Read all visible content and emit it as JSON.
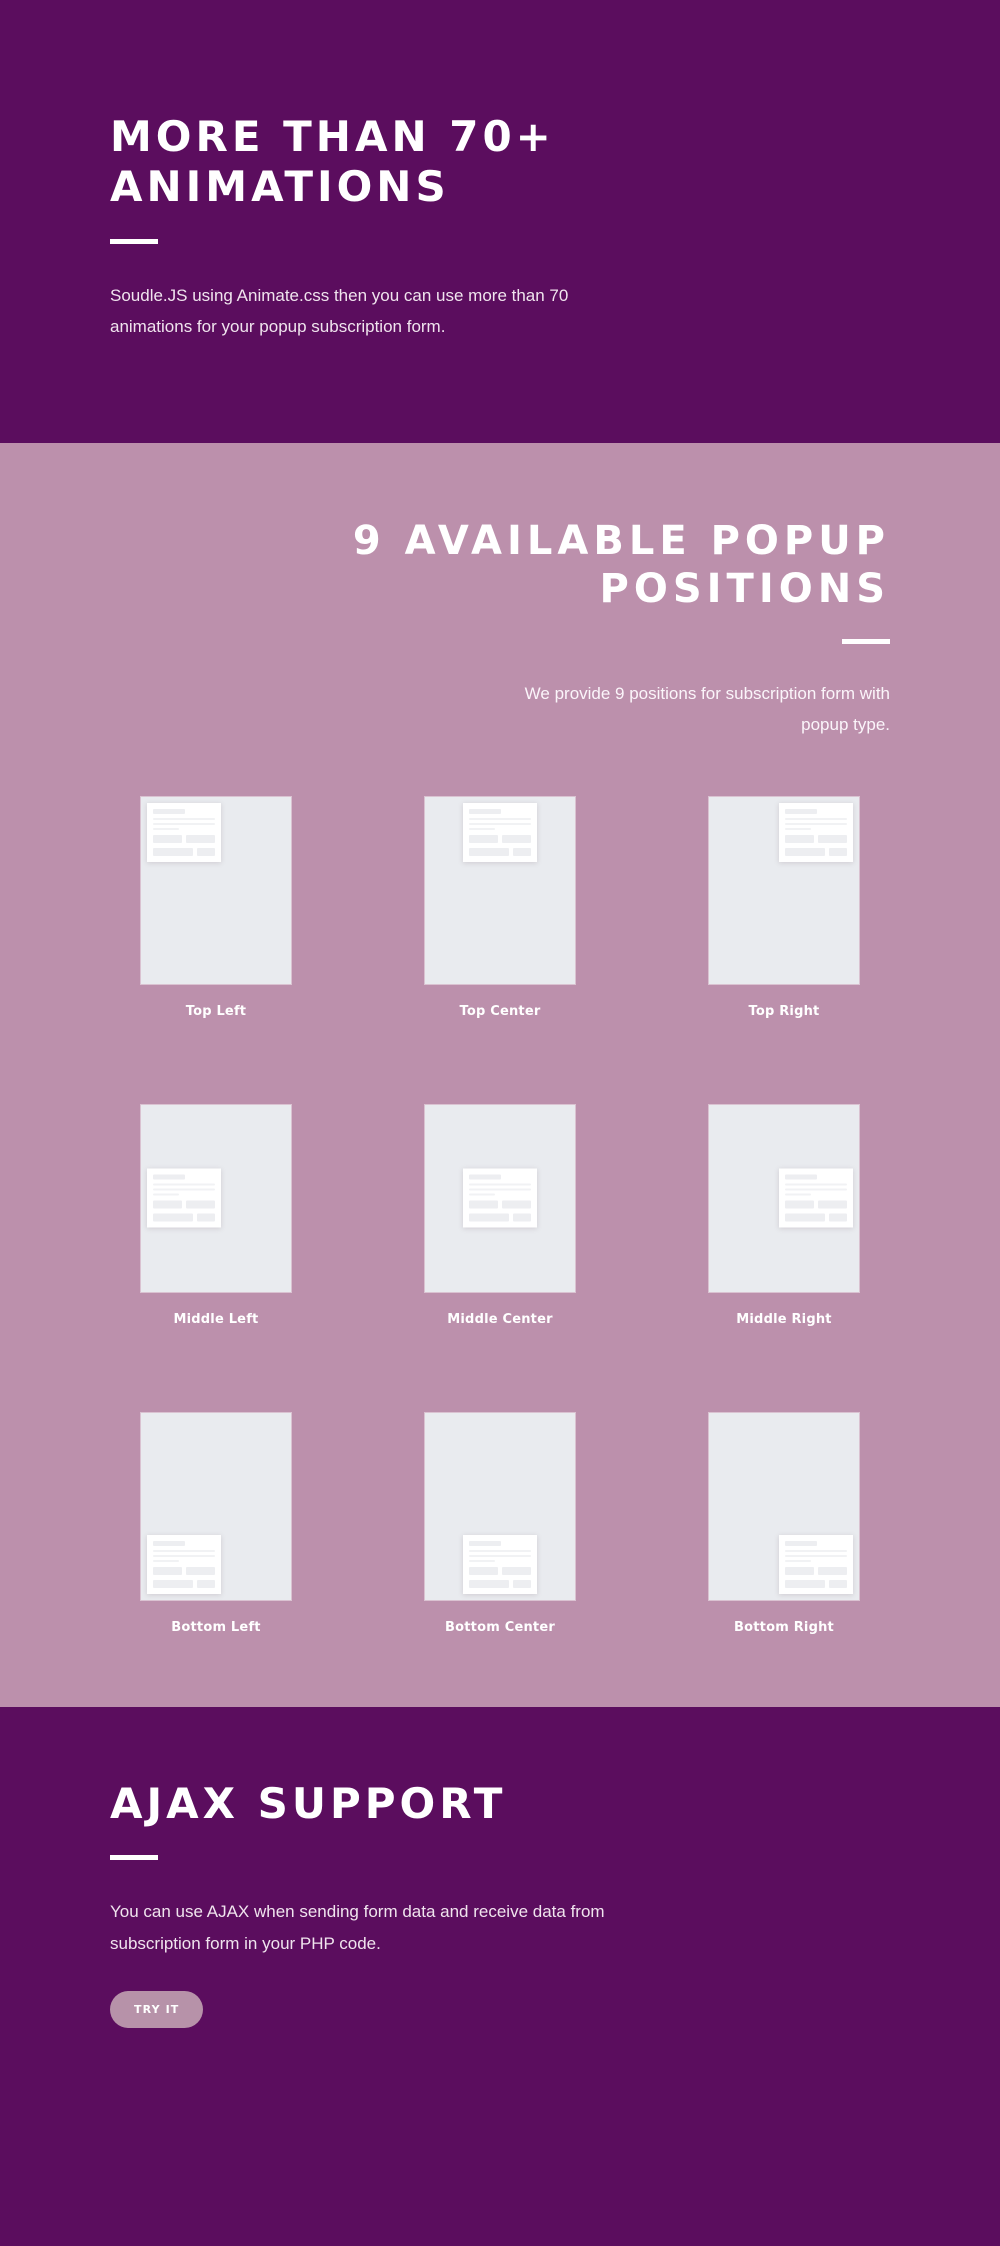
{
  "colors": {
    "purple": "#5B0D5E",
    "mauve": "#BC90AC",
    "card_bg": "#E9EBEF",
    "accent_rule": "#FFFFFF",
    "button_bg": "#B792A9",
    "text_on_purple": "#F0E4EE"
  },
  "sections": {
    "animations": {
      "heading": "More Than 70+ Animations",
      "description": "Soudle.JS using Animate.css then you can use more than 70 animations for your popup subscription form."
    },
    "positions": {
      "heading": "9 Available Popup Positions",
      "description": "We provide 9 positions for subscription form with popup type.",
      "cards": [
        {
          "label": "Top Left",
          "placement": "top-left"
        },
        {
          "label": "Top Center",
          "placement": "top-center"
        },
        {
          "label": "Top Right",
          "placement": "top-right"
        },
        {
          "label": "Middle Left",
          "placement": "middle-left"
        },
        {
          "label": "Middle Center",
          "placement": "middle-center"
        },
        {
          "label": "Middle Right",
          "placement": "middle-right"
        },
        {
          "label": "Bottom Left",
          "placement": "bottom-left"
        },
        {
          "label": "Bottom Center",
          "placement": "bottom-center"
        },
        {
          "label": "Bottom Right",
          "placement": "bottom-right"
        }
      ]
    },
    "ajax": {
      "heading": "Ajax Support",
      "description": "You can use AJAX when sending form data and receive data from subscription form in your PHP code.",
      "button_label": "Try It"
    }
  }
}
